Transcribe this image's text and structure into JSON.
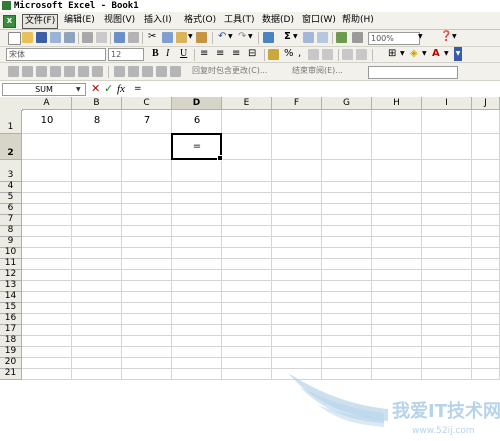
{
  "window": {
    "title": "Microsoft Excel - Book1"
  },
  "menu": {
    "items": [
      {
        "label": "文件(F)"
      },
      {
        "label": "编辑(E)"
      },
      {
        "label": "视图(V)"
      },
      {
        "label": "插入(I)"
      },
      {
        "label": "格式(O)"
      },
      {
        "label": "工具(T)"
      },
      {
        "label": "数据(D)"
      },
      {
        "label": "窗口(W)"
      },
      {
        "label": "帮助(H)"
      }
    ]
  },
  "toolbar": {
    "zoom": "100%",
    "font_name": "宋体",
    "font_size": "12",
    "bold": "B",
    "italic": "I",
    "underline": "U",
    "sigma": "Σ",
    "percent": "%",
    "reply_label": "回复时包含更改(C)...",
    "end_review_label": "结束审阅(E)..."
  },
  "formula_bar": {
    "name_box": "SUM",
    "cancel": "✕",
    "enter": "✓",
    "fx": "fx",
    "content": "="
  },
  "sheet": {
    "columns": [
      "A",
      "B",
      "C",
      "D",
      "E",
      "F",
      "G",
      "H",
      "I",
      "J"
    ],
    "rows": [
      "1",
      "2",
      "3",
      "4",
      "5",
      "6",
      "7",
      "8",
      "9",
      "10",
      "11",
      "12",
      "13",
      "14",
      "15",
      "16",
      "17",
      "18",
      "19",
      "20",
      "21"
    ],
    "cells": {
      "A1": "10",
      "B1": "8",
      "C1": "7",
      "D1": "6",
      "D2": "="
    },
    "active_cell": "D2"
  },
  "watermark": {
    "text": "我爱IT技术网",
    "url": "www.52ij.com"
  },
  "colors": {
    "titlebar_icon": "#2f7d32",
    "watermark": "#b7d3ea"
  }
}
